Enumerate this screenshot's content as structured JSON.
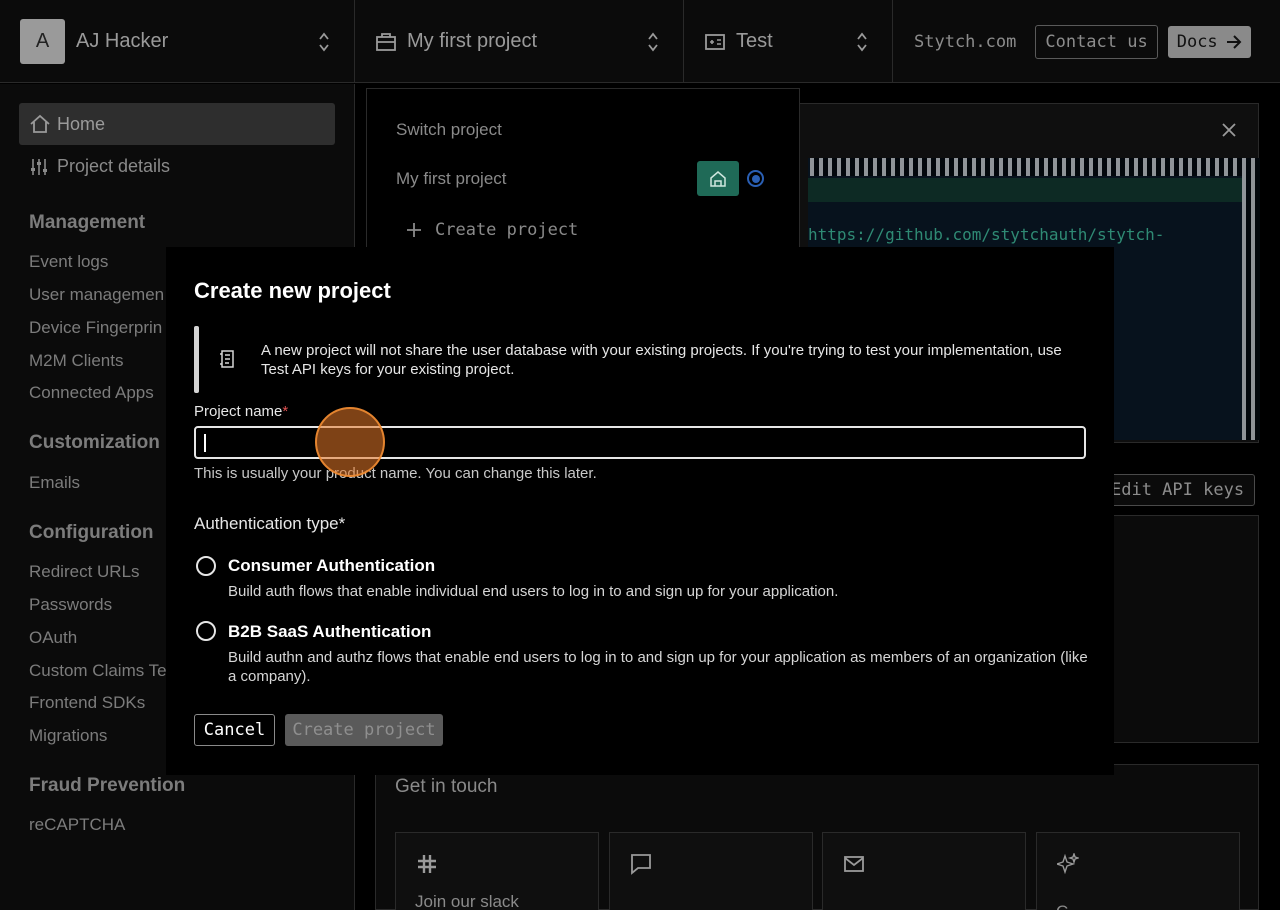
{
  "topbar": {
    "avatar_letter": "A",
    "user_name": "AJ Hacker",
    "project_name": "My first project",
    "environment": "Test",
    "links": {
      "stytch": "Stytch.com",
      "contact": "Contact us",
      "docs": "Docs"
    }
  },
  "sidebar": {
    "home": "Home",
    "project_details": "Project details",
    "sections": [
      {
        "title": "Management",
        "items": [
          "Event logs",
          "User managemen",
          "Device Fingerprin",
          "M2M Clients",
          "Connected Apps"
        ]
      },
      {
        "title": "Customization",
        "items": [
          "Emails"
        ]
      },
      {
        "title": "Configuration",
        "items": [
          "Redirect URLs",
          "Passwords",
          "OAuth",
          "Custom Claims Te",
          "Frontend SDKs",
          "Migrations"
        ]
      },
      {
        "title": "Fraud Prevention",
        "items": [
          "reCAPTCHA"
        ]
      }
    ]
  },
  "background": {
    "code_link": "https://github.com/stytchauth/stytch-",
    "edit_api_keys": "Edit API keys",
    "get_in_touch": "Get in touch",
    "join_slack": "Join our slack",
    "contact_partial": "C"
  },
  "switch_project": {
    "title": "Switch project",
    "current": "My first project",
    "create": "Create project"
  },
  "modal": {
    "title": "Create new project",
    "callout": "A new project will not share the user database with your existing projects. If you're trying to test your implementation, use Test API keys for your existing project.",
    "name_label": "Project name",
    "name_required": "*",
    "name_value": "",
    "name_hint": "This is usually your product name. You can change this later.",
    "auth_label": "Authentication type*",
    "options": [
      {
        "title": "Consumer Authentication",
        "desc": "Build auth flows that enable individual end users to log in to and sign up for your application."
      },
      {
        "title": "B2B SaaS Authentication",
        "desc": "Build authn and authz flows that enable end users to log in to and sign up for your application as members of an organization (like a company)."
      }
    ],
    "cancel": "Cancel",
    "create": "Create project"
  },
  "colors": {
    "accent_green": "#1f6a57",
    "selected_blue": "#2a5fb4",
    "required_red": "#e05252"
  }
}
